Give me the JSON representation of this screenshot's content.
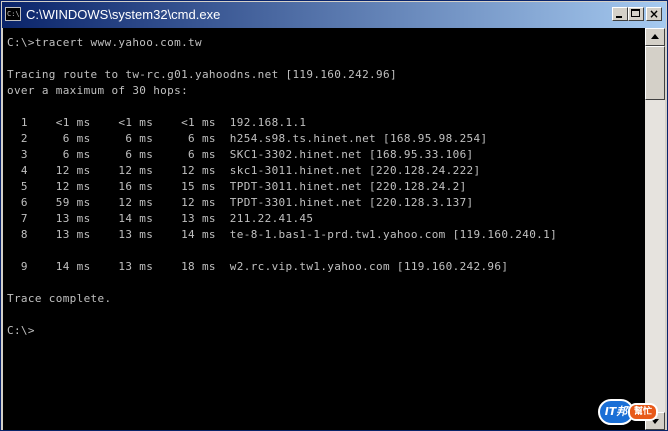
{
  "window": {
    "title": "C:\\WINDOWS\\system32\\cmd.exe",
    "icon_text": "C:\\",
    "controls": [
      "minimize",
      "maximize",
      "close"
    ],
    "close_glyph": "×"
  },
  "console": {
    "foreground": "#c0c0c0",
    "background": "#000000",
    "lines": [
      "C:\\>tracert www.yahoo.com.tw",
      "",
      "Tracing route to tw-rc.g01.yahoodns.net [119.160.242.96]",
      "over a maximum of 30 hops:",
      "",
      "  1    <1 ms    <1 ms    <1 ms  192.168.1.1",
      "  2     6 ms     6 ms     6 ms  h254.s98.ts.hinet.net [168.95.98.254]",
      "  3     6 ms     6 ms     6 ms  SKC1-3302.hinet.net [168.95.33.106]",
      "  4    12 ms    12 ms    12 ms  skc1-3011.hinet.net [220.128.24.222]",
      "  5    12 ms    16 ms    15 ms  TPDT-3011.hinet.net [220.128.24.2]",
      "  6    59 ms    12 ms    12 ms  TPDT-3301.hinet.net [220.128.3.137]",
      "  7    13 ms    14 ms    13 ms  211.22.41.45",
      "  8    13 ms    13 ms    14 ms  te-8-1.bas1-1-prd.tw1.yahoo.com [119.160.240.1]",
      "",
      "  9    14 ms    13 ms    18 ms  w2.rc.vip.tw1.yahoo.com [119.160.242.96]",
      "",
      "Trace complete.",
      "",
      "C:\\>"
    ]
  },
  "watermark": {
    "badge_text": "IT邦",
    "tag_text": "幫忙"
  },
  "colors": {
    "titlebar_start": "#0a246a",
    "titlebar_end": "#a6caf0",
    "chrome": "#d4d0c8"
  }
}
